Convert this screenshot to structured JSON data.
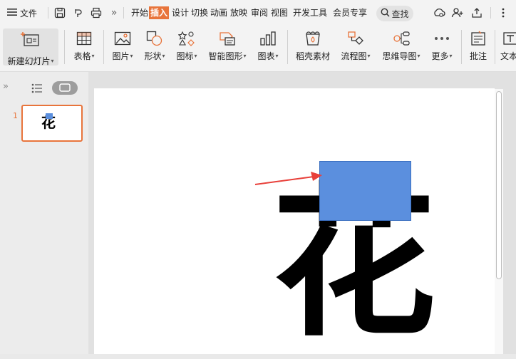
{
  "menubar": {
    "menu_label": "文件",
    "tabs": [
      "开始",
      "插入",
      "设计",
      "切换",
      "动画",
      "放映",
      "审阅",
      "视图",
      "开发工具",
      "会员专享"
    ],
    "active_tab": "插入",
    "search_label": "查找"
  },
  "ribbon": {
    "new_slide": "新建幻灯片",
    "buttons": [
      {
        "label": "表格",
        "icon": "table-icon",
        "dropdown": true
      },
      {
        "label": "图片",
        "icon": "picture-icon",
        "dropdown": true
      },
      {
        "label": "形状",
        "icon": "shape-icon",
        "dropdown": true
      },
      {
        "label": "图标",
        "icon": "icons-icon",
        "dropdown": true
      },
      {
        "label": "智能图形",
        "icon": "smartart-icon",
        "dropdown": true
      },
      {
        "label": "图表",
        "icon": "chart-icon",
        "dropdown": true
      },
      {
        "label": "稻壳素材",
        "icon": "docer-material-icon",
        "dropdown": false
      },
      {
        "label": "流程图",
        "icon": "flowchart-icon",
        "dropdown": true
      },
      {
        "label": "思维导图",
        "icon": "mindmap-icon",
        "dropdown": true
      },
      {
        "label": "更多",
        "icon": "more-icon",
        "dropdown": true
      },
      {
        "label": "批注",
        "icon": "comment-icon",
        "dropdown": false
      },
      {
        "label": "文本",
        "icon": "textbox-icon",
        "dropdown": false
      }
    ]
  },
  "sidepanel": {
    "slide_number": "1",
    "thumbnail_text": "花"
  },
  "slide": {
    "big_character": "花",
    "rect_color": "#5b8fde",
    "arrow_color": "#e8403a"
  },
  "colors": {
    "accent": "#e8743b"
  }
}
